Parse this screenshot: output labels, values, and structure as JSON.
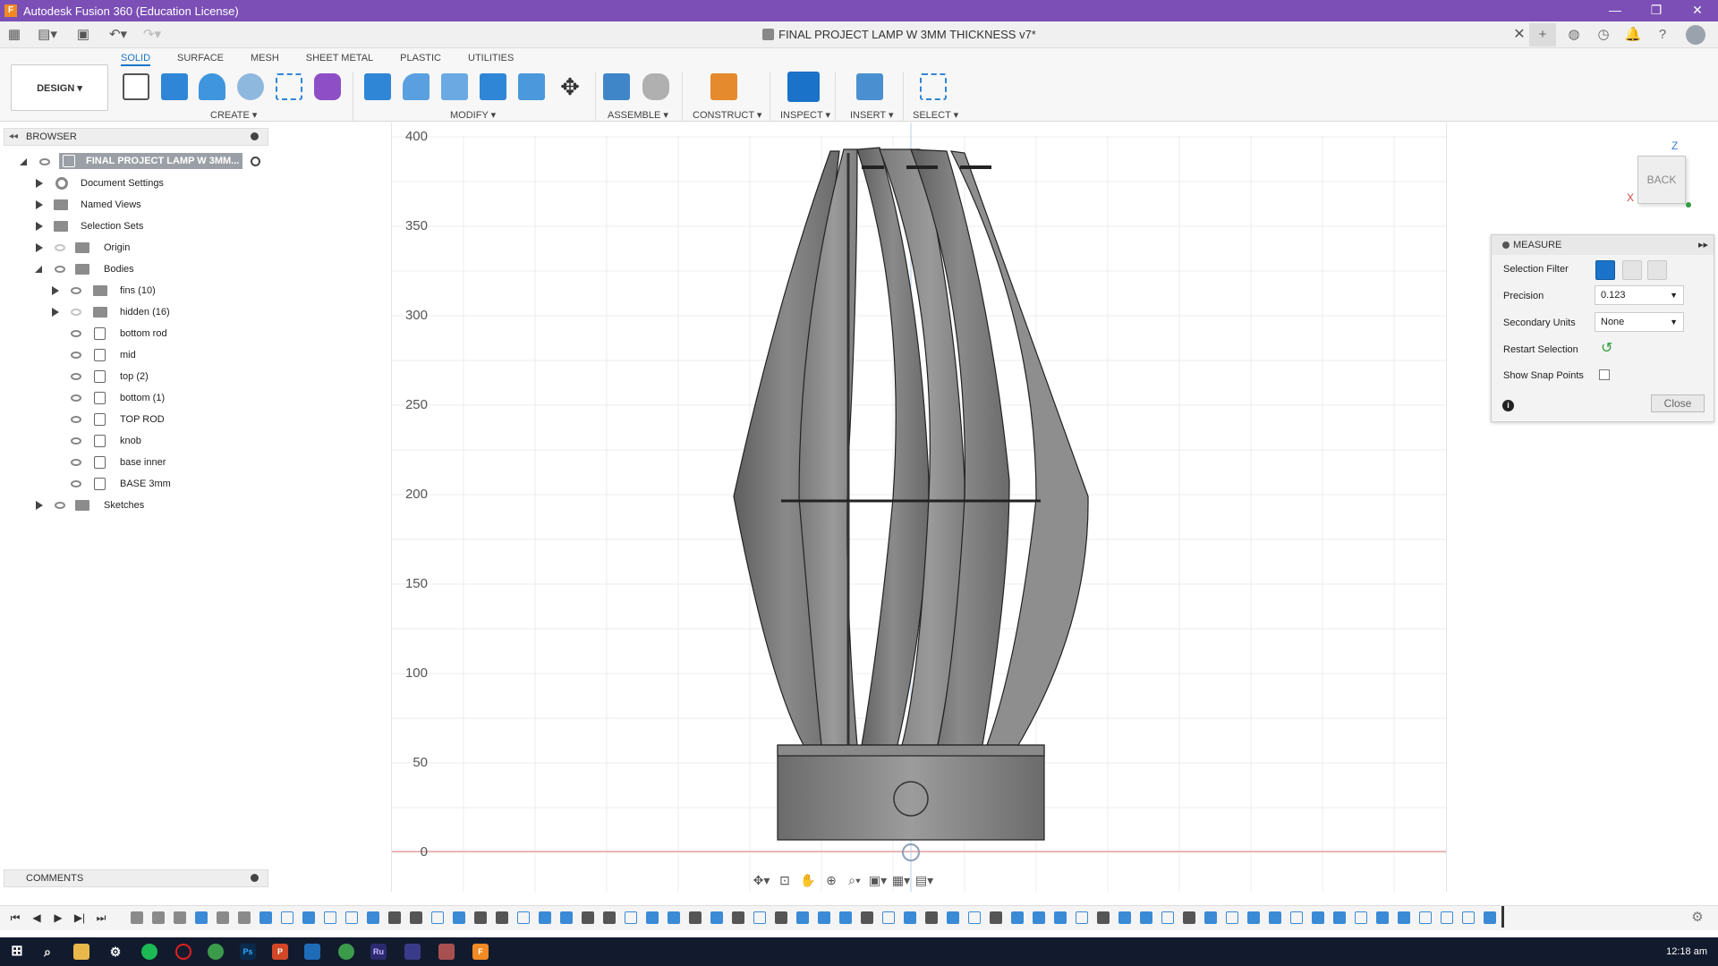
{
  "window": {
    "title": "Autodesk Fusion 360 (Education License)",
    "app_icon": "fusion-360-icon",
    "controls": [
      "—",
      "❐",
      "✕"
    ]
  },
  "document_tab": {
    "title": "FINAL PROJECT LAMP W 3MM THICKNESS v7*"
  },
  "workspace": {
    "design_label": "DESIGN ▾"
  },
  "toolbar": {
    "tabs": [
      {
        "label": "SOLID",
        "active": true
      },
      {
        "label": "SURFACE"
      },
      {
        "label": "MESH"
      },
      {
        "label": "SHEET METAL"
      },
      {
        "label": "PLASTIC"
      },
      {
        "label": "UTILITIES"
      }
    ],
    "groups": [
      {
        "label": "CREATE ▾"
      },
      {
        "label": "MODIFY ▾"
      },
      {
        "label": "ASSEMBLE ▾"
      },
      {
        "label": "CONSTRUCT ▾"
      },
      {
        "label": "INSPECT ▾"
      },
      {
        "label": "INSERT ▾"
      },
      {
        "label": "SELECT ▾"
      }
    ],
    "accent_color": "#1a73c8"
  },
  "browser": {
    "header": "BROWSER",
    "root": "FINAL PROJECT LAMP W 3MM...",
    "items": [
      {
        "label": "Document Settings"
      },
      {
        "label": "Named Views"
      },
      {
        "label": "Selection Sets"
      },
      {
        "label": "Origin"
      },
      {
        "label": "Bodies"
      },
      {
        "label": "fins (10)"
      },
      {
        "label": "hidden (16)"
      },
      {
        "label": "bottom rod"
      },
      {
        "label": "mid"
      },
      {
        "label": "top (2)"
      },
      {
        "label": "bottom  (1)"
      },
      {
        "label": "TOP ROD"
      },
      {
        "label": "knob"
      },
      {
        "label": "base inner"
      },
      {
        "label": "BASE 3mm"
      },
      {
        "label": "Sketches"
      }
    ]
  },
  "comments": {
    "header": "COMMENTS"
  },
  "viewport": {
    "y_ticks": [
      "400",
      "350",
      "300",
      "250",
      "200",
      "150",
      "100",
      "50",
      "0"
    ],
    "view_cube_face": "BACK",
    "axis_z": "Z",
    "axis_x": "X",
    "model_color": "#7a7a7a"
  },
  "measure": {
    "header": "MEASURE",
    "selection_filter_label": "Selection Filter",
    "precision_label": "Precision",
    "precision_value": "0.123",
    "secondary_units_label": "Secondary Units",
    "secondary_units_value": "None",
    "restart_label": "Restart Selection",
    "snap_label": "Show Snap Points",
    "close_label": "Close"
  },
  "taskbar": {
    "time": "12:18 am"
  }
}
